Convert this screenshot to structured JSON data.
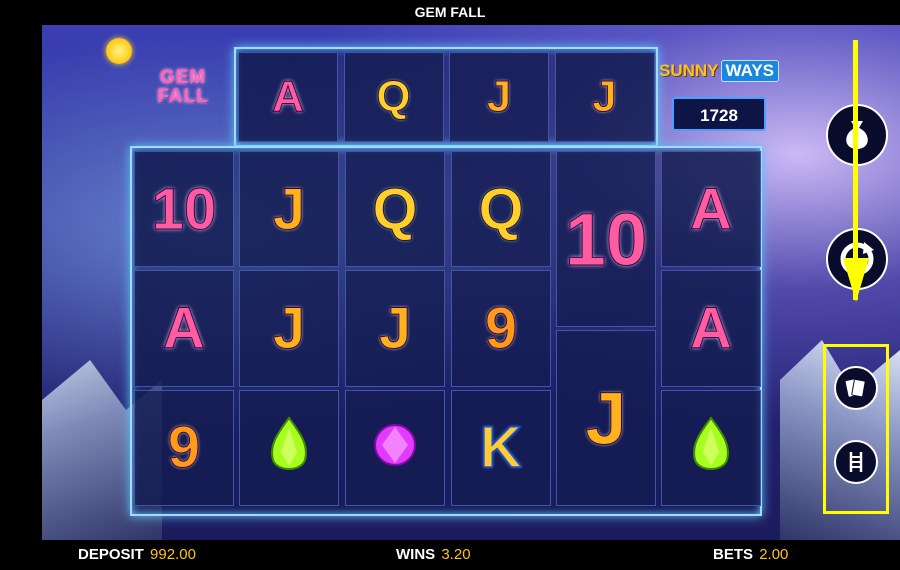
{
  "window": {
    "title": "GEM FALL"
  },
  "branding": {
    "game_logo": "GEM FALL",
    "brand_left": "SUNNY",
    "brand_right": "WAYS"
  },
  "counter": {
    "ways": "1728"
  },
  "top_reel": [
    "A",
    "Q",
    "J",
    "J"
  ],
  "reels": [
    [
      {
        "sym": "10",
        "color": "pink"
      },
      {
        "sym": "A",
        "color": "pink"
      },
      {
        "sym": "9",
        "color": "orange"
      }
    ],
    [
      {
        "sym": "J",
        "color": "gold"
      },
      {
        "sym": "J",
        "color": "gold"
      },
      {
        "sym": "green-gem",
        "color": "green"
      }
    ],
    [
      {
        "sym": "Q",
        "color": "green"
      },
      {
        "sym": "J",
        "color": "gold"
      },
      {
        "sym": "pink-gem",
        "color": "magenta"
      }
    ],
    [
      {
        "sym": "Q",
        "color": "green"
      },
      {
        "sym": "9",
        "color": "orange"
      },
      {
        "sym": "K",
        "color": "blue"
      }
    ],
    [
      {
        "sym": "10",
        "color": "pink"
      },
      {
        "sym": "J",
        "color": "gold"
      }
    ],
    [
      {
        "sym": "A",
        "color": "pink"
      },
      {
        "sym": "A",
        "color": "pink"
      },
      {
        "sym": "green-gem",
        "color": "green"
      }
    ]
  ],
  "controls": {
    "side_buttons": [
      "money-bag-icon",
      "spin-icon"
    ],
    "highlighted_buttons": [
      "cards-icon",
      "ladder-icon"
    ]
  },
  "status": {
    "deposit_label": "DEPOSIT",
    "deposit_value": "992.00",
    "wins_label": "WINS",
    "wins_value": "3.20",
    "bets_label": "BETS",
    "bets_value": "2.00"
  },
  "colors": {
    "highlight": "#ffff00",
    "frame_glow": "#5ec2ff",
    "value_gold": "#ffc21a"
  }
}
